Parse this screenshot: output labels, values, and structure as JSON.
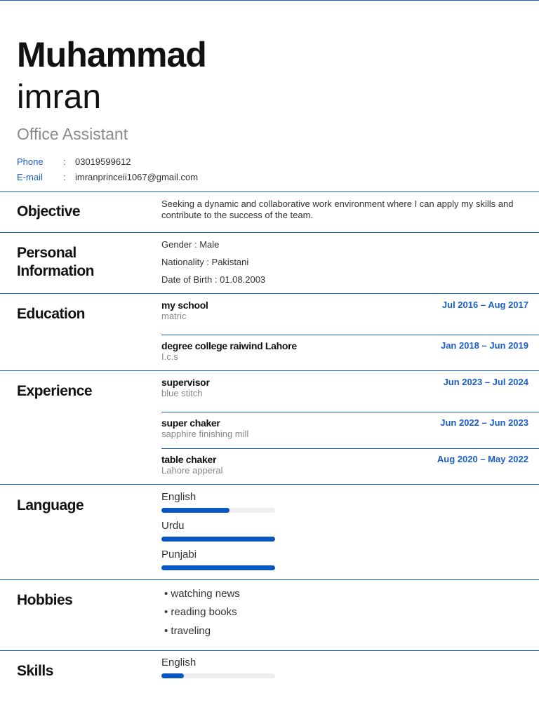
{
  "header": {
    "first_name": "Muhammad",
    "last_name": "imran",
    "role": "Office Assistant",
    "contacts": [
      {
        "label": "Phone",
        "sep": ":",
        "value": "03019599612"
      },
      {
        "label": "E-mail",
        "sep": ":",
        "value": "imranprinceii1067@gmail.com"
      }
    ]
  },
  "objective": {
    "title": "Objective",
    "text": "Seeking a dynamic and collaborative work environment where I can apply my skills and contribute to the success of the team."
  },
  "personal": {
    "title1": "Personal",
    "title2": "Information",
    "items": [
      "Gender : Male",
      "Nationality : Pakistani",
      "Date of Birth : 01.08.2003"
    ]
  },
  "education": {
    "title": "Education",
    "items": [
      {
        "title": "my school",
        "sub": "matric",
        "date": "Jul 2016 – Aug 2017"
      },
      {
        "title": "degree college raiwind Lahore",
        "sub": "I.c.s",
        "date": "Jan 2018 – Jun 2019"
      }
    ]
  },
  "experience": {
    "title": "Experience",
    "items": [
      {
        "title": "supervisor",
        "sub": "blue stitch",
        "date": "Jun 2023 – Jul 2024"
      },
      {
        "title": "super chaker",
        "sub": "sapphire finishing mill",
        "date": "Jun 2022 – Jun 2023"
      },
      {
        "title": "table chaker",
        "sub": "Lahore apperal",
        "date": "Aug 2020 – May 2022"
      }
    ]
  },
  "language": {
    "title": "Language",
    "items": [
      {
        "name": "English",
        "level": 0.6
      },
      {
        "name": "Urdu",
        "level": 1.0
      },
      {
        "name": "Punjabi",
        "level": 1.0
      }
    ]
  },
  "hobbies": {
    "title": "Hobbies",
    "items": [
      "• watching news",
      "• reading books",
      "• traveling"
    ]
  },
  "skills": {
    "title": "Skills",
    "items": [
      {
        "name": "English",
        "level": 0.2
      }
    ]
  },
  "colors": {
    "accent": "#1a5fc8",
    "bar": "#0a56c2"
  }
}
